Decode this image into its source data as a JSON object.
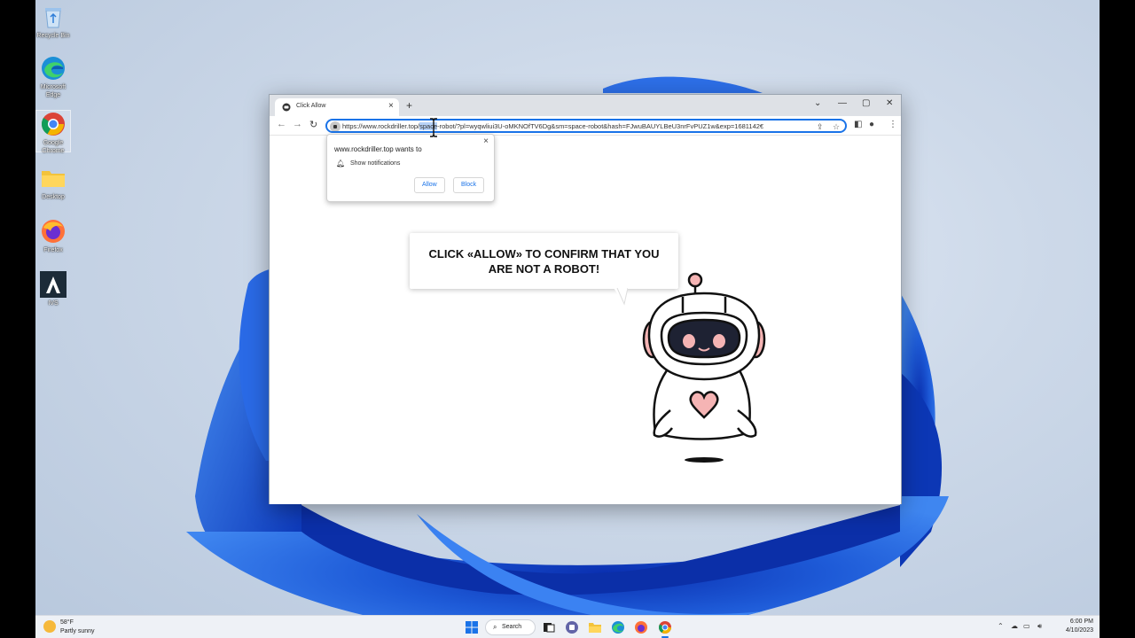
{
  "desktop": {
    "icons": [
      {
        "label": "Recycle Bin"
      },
      {
        "label": "Microsoft Edge"
      },
      {
        "label": "Google Chrome"
      },
      {
        "label": "Desktop"
      },
      {
        "label": "Firefox"
      },
      {
        "label": "IVS"
      }
    ]
  },
  "browser": {
    "tab_title": "Click Allow",
    "url_start": "https://www.rockdriller.top/",
    "url_selected": "space",
    "url_end": "-robot/?pl=wyqwliui3U-oMKNOfTV6Dg&sm=space-robot&hash=FJwuBAUYLBeU3nrFvPUZ1w&exp=1681142€",
    "permission_popup": {
      "title": "www.rockdriller.top wants to",
      "item": "Show notifications",
      "allow_label": "Allow",
      "block_label": "Block"
    },
    "page": {
      "bubble_text": "CLICK «ALLOW» TO CONFIRM THAT YOU ARE NOT A ROBOT!"
    }
  },
  "taskbar": {
    "weather_temp": "58°F",
    "weather_desc": "Partly sunny",
    "search_label": "Search",
    "time": "6:00 PM",
    "date": "4/10/2023"
  },
  "colors": {
    "accent": "#1a73e8",
    "wallpaper_blue": "#1e5bd8",
    "robot_pink": "#f5b4b4"
  }
}
